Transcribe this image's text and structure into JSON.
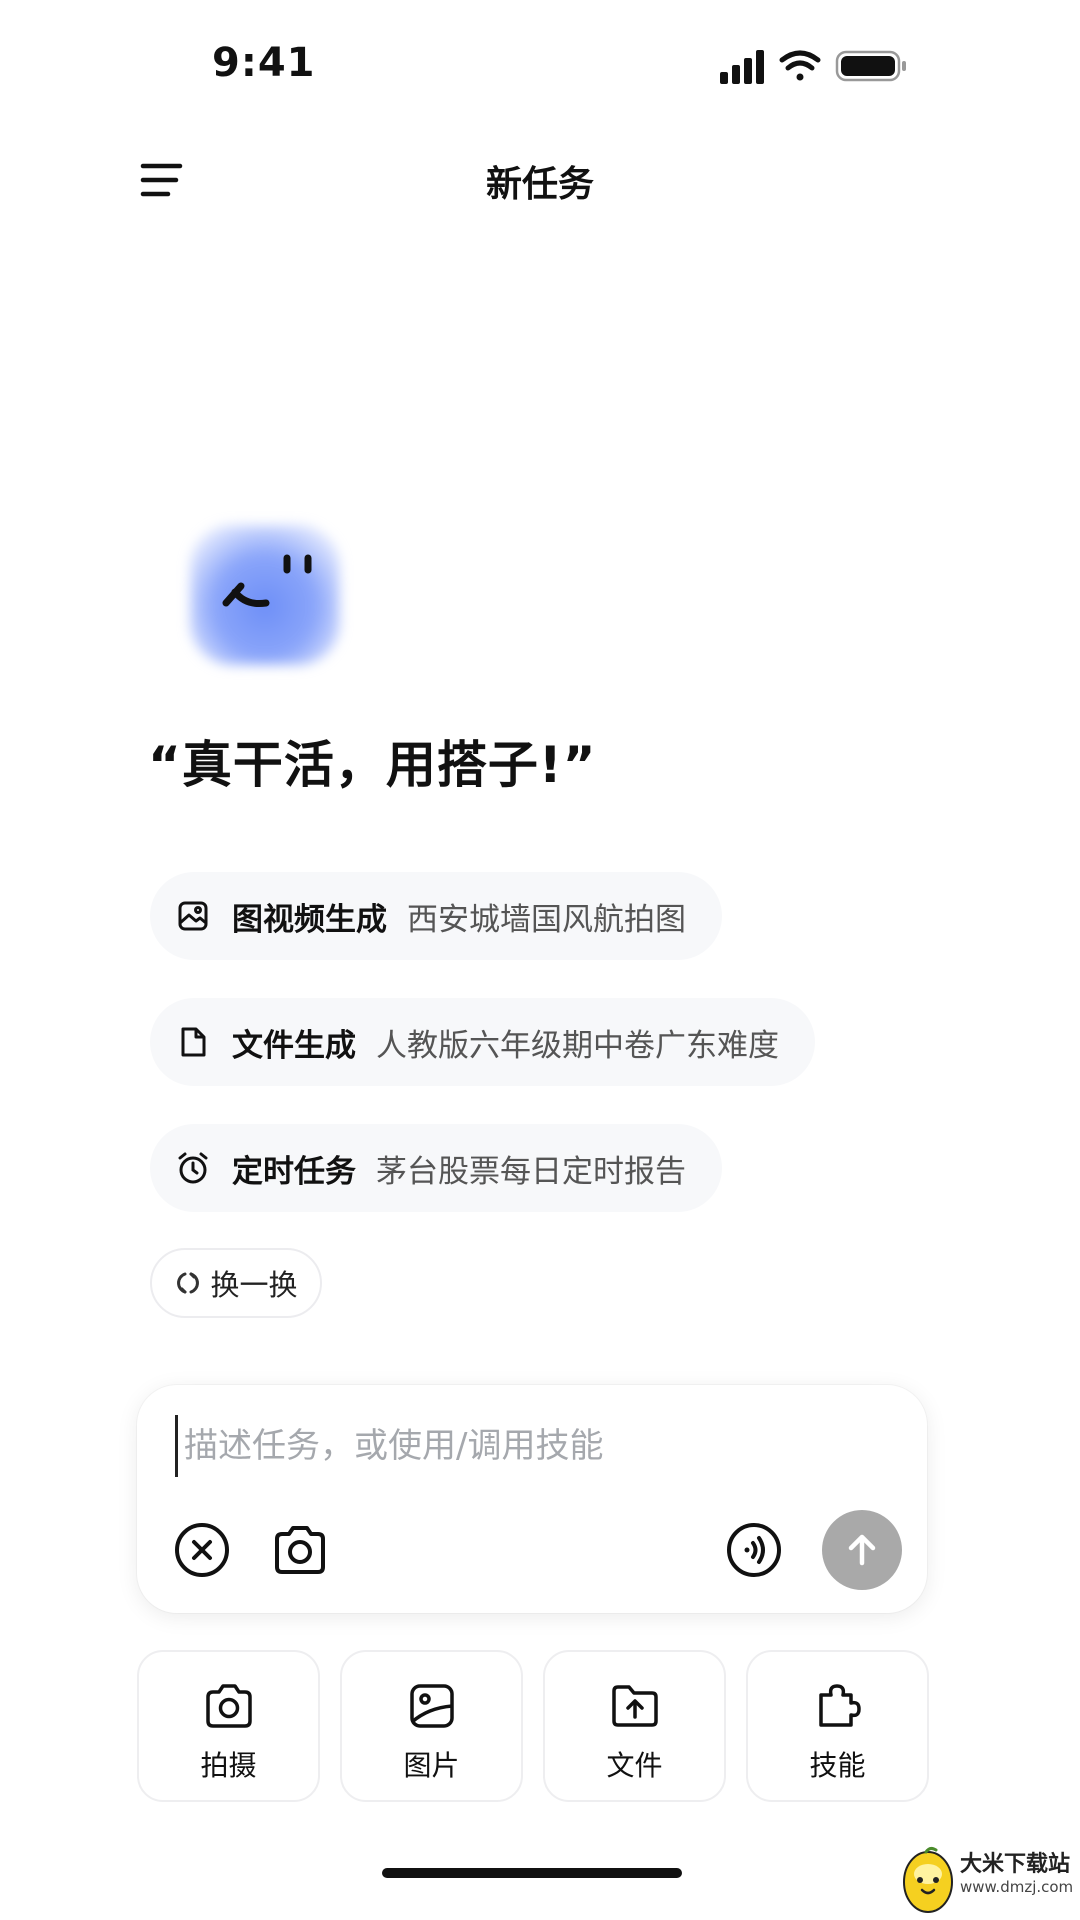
{
  "status_bar": {
    "time": "9:41"
  },
  "nav": {
    "title": "新任务"
  },
  "hero": {
    "slogan": "“真干活，用搭子!”"
  },
  "suggestions": [
    {
      "icon": "image-icon",
      "category": "图视频生成",
      "example": "西安城墙国风航拍图"
    },
    {
      "icon": "file-icon",
      "category": "文件生成",
      "example": "人教版六年级期中卷广东难度"
    },
    {
      "icon": "alarm-clock-icon",
      "category": "定时任务",
      "example": "茅台股票每日定时报告"
    }
  ],
  "refresh_label": "换一换",
  "input": {
    "placeholder": "描述任务，或使用/调用技能",
    "value": ""
  },
  "quick_actions": [
    {
      "icon": "camera-icon",
      "label": "拍摄"
    },
    {
      "icon": "image-icon",
      "label": "图片"
    },
    {
      "icon": "folder-upload-icon",
      "label": "文件"
    },
    {
      "icon": "puzzle-icon",
      "label": "技能"
    }
  ],
  "watermark": {
    "name": "大米下载站",
    "url": "www.dmzj.com"
  },
  "colors": {
    "accent_blue": "#7b97f8",
    "send_button": "#a9a9a9",
    "chip_bg": "#f7f8fa"
  }
}
